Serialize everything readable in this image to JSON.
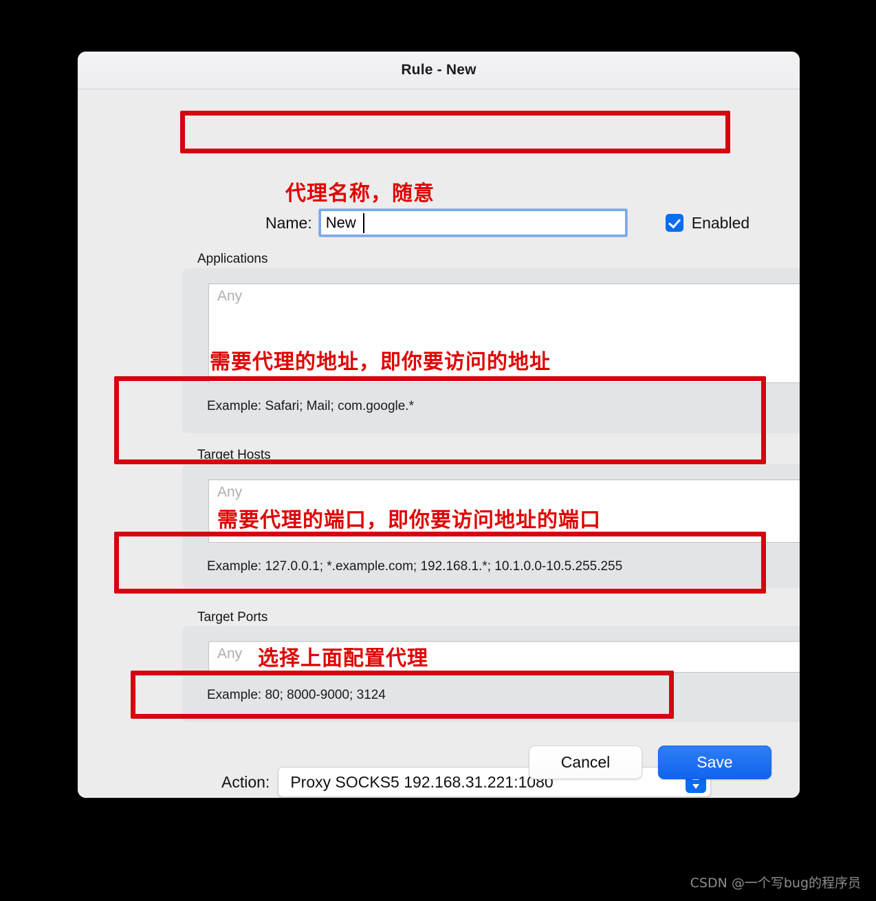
{
  "window": {
    "title": "Rule - New"
  },
  "name_row": {
    "label": "Name:",
    "value": "New",
    "placeholder": "",
    "enabled_label": "Enabled",
    "enabled_checked": true
  },
  "applications": {
    "label": "Applications",
    "placeholder": "Any",
    "value": "",
    "example": "Example: Safari; Mail; com.google.*",
    "add_icon": "plus-icon"
  },
  "target_hosts": {
    "label": "Target Hosts",
    "placeholder": "Any",
    "value": "",
    "example": "Example: 127.0.0.1; *.example.com; 192.168.1.*; 10.1.0.0-10.5.255.255"
  },
  "target_ports": {
    "label": "Target Ports",
    "placeholder": "Any",
    "value": "",
    "example": "Example: 80; 8000-9000; 3124"
  },
  "action": {
    "label": "Action:",
    "selected": "Proxy SOCKS5 192.168.31.221:1080",
    "stepper_icon": "chevron-up-down-icon"
  },
  "footer": {
    "cancel_label": "Cancel",
    "save_label": "Save"
  },
  "annotations": {
    "name": "代理名称，随意",
    "hosts": "需要代理的地址，即你要访问的地址",
    "ports": "需要代理的端口，即你要访问地址的端口",
    "action": "选择上面配置代理",
    "color": "#e00000"
  },
  "watermark": {
    "text": "CSDN @一个写bug的程序员"
  }
}
